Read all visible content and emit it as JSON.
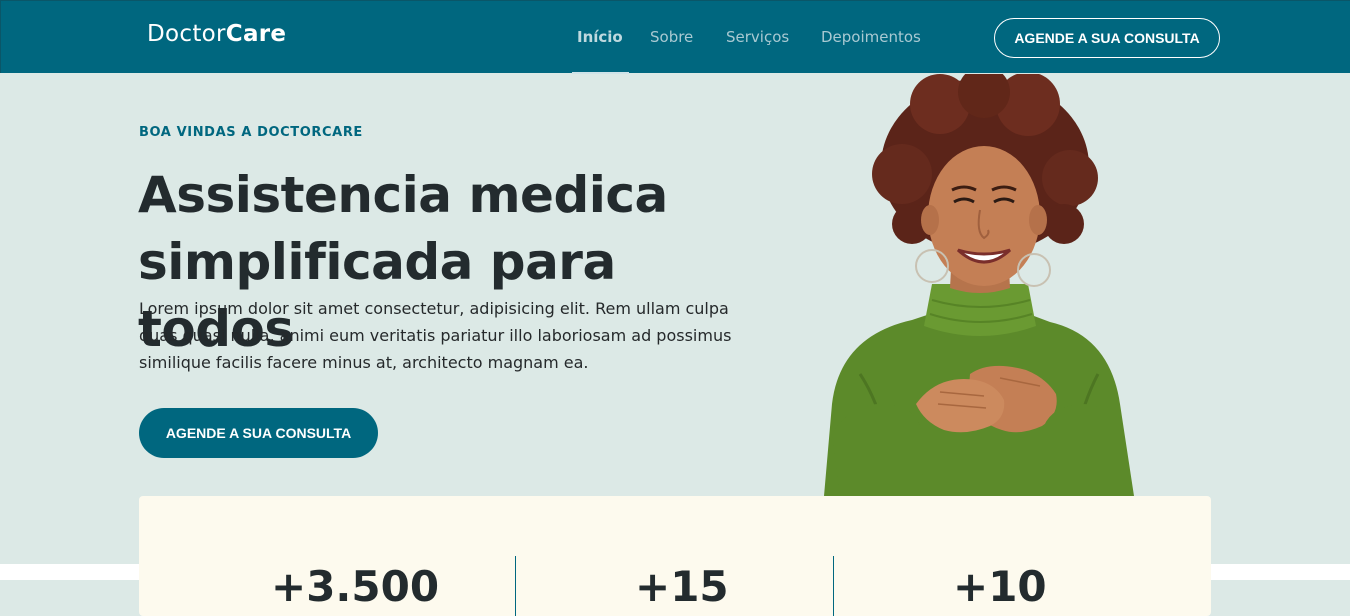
{
  "header": {
    "logo_light": "Doctor",
    "logo_bold": "Care",
    "nav": [
      {
        "label": "Início",
        "active": true
      },
      {
        "label": "Sobre",
        "active": false
      },
      {
        "label": "Serviços",
        "active": false
      },
      {
        "label": "Depoimentos",
        "active": false
      }
    ],
    "cta_label": "AGENDE A SUA CONSULTA"
  },
  "hero": {
    "eyebrow": "BOA VINDAS A DOCTORCARE",
    "title_line1": "Assistencia medica",
    "title_line2": "simplificada para todos",
    "description": "Lorem ipsum dolor sit amet consectetur, adipisicing elit. Rem ullam culpa quas quasi nulla, animi eum veritatis pariatur illo laboriosam ad possimus similique facilis facere minus at, architecto magnam ea.",
    "cta_label": "AGENDE A SUA CONSULTA"
  },
  "stats": {
    "items": [
      {
        "value": "+3.500"
      },
      {
        "value": "+15"
      },
      {
        "value": "+10"
      }
    ]
  },
  "colors": {
    "primary": "#00677f",
    "hero_background": "#dce9e6",
    "stats_background": "#fdfaee",
    "heading": "#232b2e"
  }
}
